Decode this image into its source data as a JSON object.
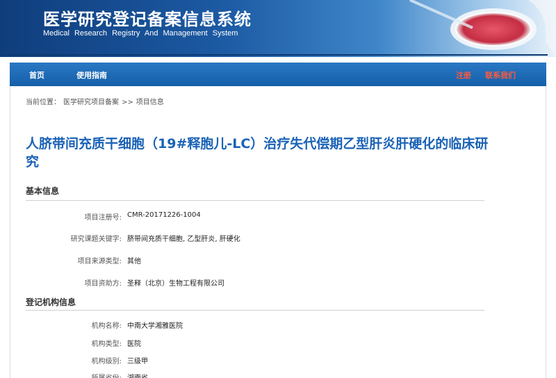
{
  "header": {
    "title_cn": "医学研究登记备案信息系统",
    "title_en": "Medical Research Registry And Management System"
  },
  "nav": {
    "home": "首页",
    "guide": "使用指南",
    "register": "注册",
    "contact": "联系我们"
  },
  "breadcrumb": {
    "prefix": "当前位置：",
    "level1": "医学研究项目备案",
    "sep": ">>",
    "level2": "项目信息"
  },
  "project": {
    "title": "人脐带间充质干细胞（19#释胞儿-LC）治疗失代偿期乙型肝炎肝硬化的临床研究"
  },
  "basic_info": {
    "heading": "基本信息",
    "fields": [
      {
        "label": "项目注册号:",
        "value": "CMR-20171226-1004"
      },
      {
        "label": "研究课题关键字:",
        "value": "脐带间充质干细胞, 乙型肝炎, 肝硬化"
      },
      {
        "label": "项目来源类型:",
        "value": "其他"
      },
      {
        "label": "项目资助方:",
        "value": "圣释（北京）生物工程有限公司"
      }
    ]
  },
  "institution_info": {
    "heading": "登记机构信息",
    "fields": [
      {
        "label": "机构名称:",
        "value": "中南大学湘雅医院"
      },
      {
        "label": "机构类型:",
        "value": "医院"
      },
      {
        "label": "机构级别:",
        "value": "三级甲"
      },
      {
        "label": "所属省份:",
        "value": "湖南省"
      }
    ]
  }
}
